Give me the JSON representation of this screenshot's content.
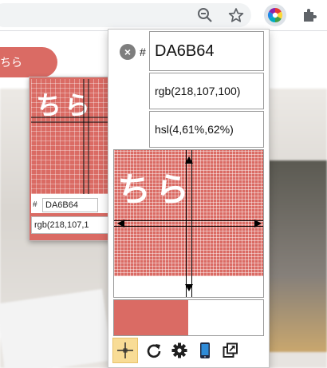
{
  "toolbar": {
    "zoom_icon": "zoom-out-icon",
    "star_icon": "star-icon",
    "extension_icon": "color-wheel-icon",
    "puzzle_icon": "puzzle-icon"
  },
  "page": {
    "pill_label": "ちら",
    "mini_picker": {
      "glyphs": "ちら",
      "hash": "#",
      "hex": "DA6B64",
      "rgb": "rgb(218,107,1"
    }
  },
  "popup": {
    "clear_label": "×",
    "hash": "#",
    "hex": "DA6B64",
    "rgb": "rgb(218,107,100)",
    "hsl": "hsl(4,61%,62%)",
    "zoom_glyphs": "ちら",
    "current_color": "#da6b64",
    "previous_color": "#ffffff",
    "tools": [
      {
        "name": "crosshair-icon",
        "active": true
      },
      {
        "name": "refresh-icon",
        "active": false
      },
      {
        "name": "settings-gear-icon",
        "active": false
      },
      {
        "name": "mobile-device-icon",
        "active": false
      },
      {
        "name": "external-window-icon",
        "active": false
      }
    ]
  },
  "colors": {
    "accent": "#da6b64",
    "active_tool": "#f8dc96"
  }
}
